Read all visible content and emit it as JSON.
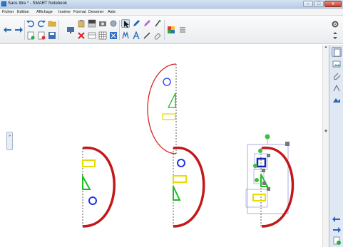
{
  "window": {
    "title": "Sans titre * - SMART Notebook",
    "minimize": "–",
    "maximize": "□",
    "close": "x"
  },
  "menu": {
    "items": [
      "Fichier",
      "Edition",
      "Affichage",
      "Insérer",
      "Format",
      "Dessiner",
      "Aide"
    ]
  },
  "toolbar": {
    "icons": [
      "back-arrow-icon",
      "forward-arrow-icon",
      "undo-icon",
      "redo-icon",
      "open-file-icon",
      "save-icon",
      "add-page-icon",
      "delete-icon",
      "screen-shade-icon",
      "table-icon",
      "capture-icon",
      "select-arrow-icon",
      "pen-icon",
      "eraser-icon",
      "magic-pen-icon",
      "text-icon",
      "line-icon",
      "shape-icon",
      "fill-color-icon",
      "properties-icon"
    ],
    "right_tools": [
      "settings-icon",
      "move-toolbar-icon"
    ]
  },
  "sidebar": {
    "tabs": [
      "page-sorter-icon",
      "gallery-icon",
      "attachments-icon",
      "properties-icon",
      "addons-icon"
    ],
    "bottom": [
      "previous-page-icon",
      "next-page-icon",
      "add-page-icon"
    ]
  },
  "colors": {
    "red": "#e02020",
    "green": "#22bb22",
    "blue": "#2233ee",
    "yellow": "#e6dd00",
    "selection": "#8888dd"
  }
}
